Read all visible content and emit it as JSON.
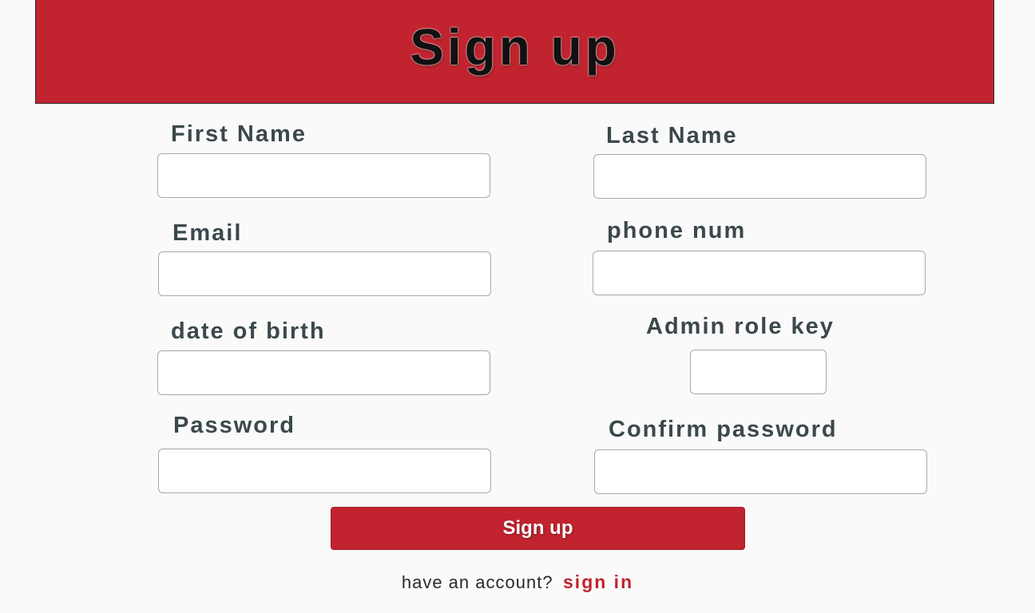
{
  "header": {
    "title": "Sign up"
  },
  "form": {
    "first_name": {
      "label": "First Name",
      "value": "",
      "placeholder": ""
    },
    "last_name": {
      "label": "Last Name",
      "value": "",
      "placeholder": ""
    },
    "email": {
      "label": "Email",
      "value": "",
      "placeholder": ""
    },
    "phone": {
      "label": "phone num",
      "value": "",
      "placeholder": ""
    },
    "dob": {
      "label": "date of birth",
      "value": "",
      "placeholder": ""
    },
    "admin_key": {
      "label": "Admin role key",
      "value": "",
      "placeholder": ""
    },
    "password": {
      "label": "Password",
      "value": "",
      "placeholder": ""
    },
    "confirm_password": {
      "label": "Confirm password",
      "value": "",
      "placeholder": ""
    },
    "submit_label": "Sign up"
  },
  "footer": {
    "prompt": "have an account?",
    "link_label": "sign in"
  },
  "colors": {
    "brand": "#c1242f",
    "label_text": "#3b484c",
    "background": "#fafafa"
  }
}
